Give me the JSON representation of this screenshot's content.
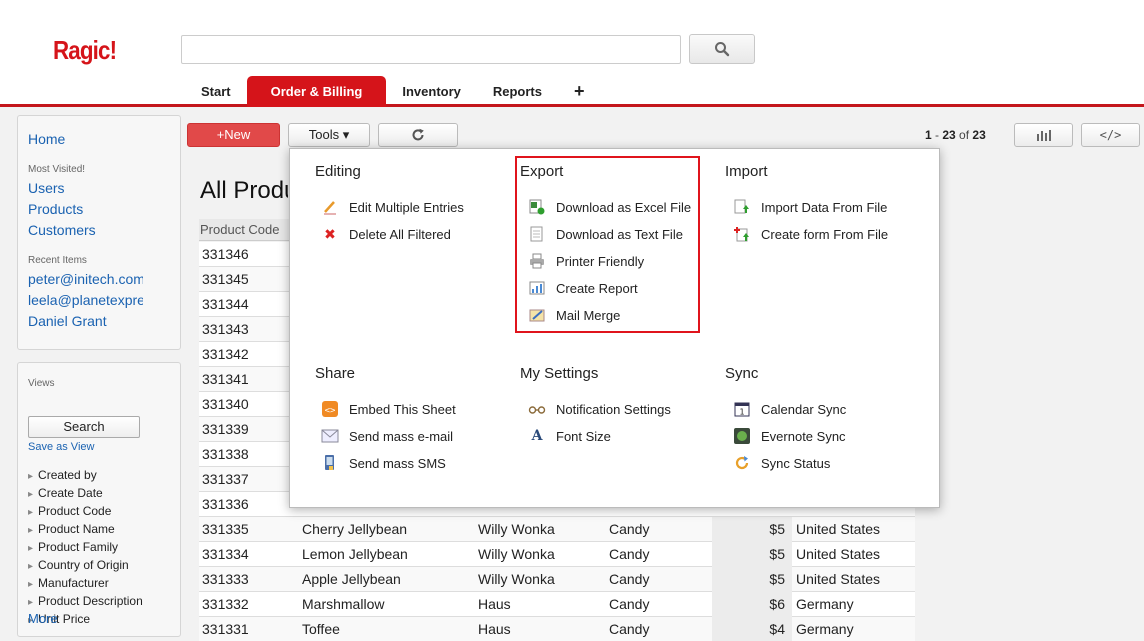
{
  "app": {
    "logo": "Ragic!"
  },
  "search": {
    "placeholder": ""
  },
  "tabs": [
    {
      "label": "Start"
    },
    {
      "label": "Order & Billing"
    },
    {
      "label": "Inventory"
    },
    {
      "label": "Reports"
    },
    {
      "label": "+"
    }
  ],
  "sidebar": {
    "home": "Home",
    "most_visited_label": "Most Visited!",
    "most_visited": [
      "Users",
      "Products",
      "Customers"
    ],
    "recent_label": "Recent Items",
    "recent": [
      "peter@initech.com",
      "leela@planetexpres",
      "Daniel Grant"
    ],
    "views_label": "Views",
    "search_button": "Search",
    "save_as_view": "Save as View",
    "filters": [
      "Created by",
      "Create Date",
      "Product Code",
      "Product Name",
      "Product Family",
      "Country of Origin",
      "Manufacturer",
      "Product Description",
      "Unit Price"
    ],
    "more": "More"
  },
  "toolbar": {
    "new_label": "+New",
    "tools_label": "Tools ▾",
    "pager_start": "1",
    "pager_sep": " - ",
    "pager_end": "23",
    "pager_of": " of ",
    "pager_total": "23",
    "code_label": "</>"
  },
  "main": {
    "title": "All Products",
    "col_product_code": "Product Code",
    "codes": [
      "331346",
      "331345",
      "331344",
      "331343",
      "331342",
      "331341",
      "331340",
      "331339",
      "331338",
      "331337",
      "331336"
    ],
    "rows": [
      {
        "code": "331335",
        "name": "Cherry Jellybean",
        "manufacturer": "Willy Wonka",
        "family": "Candy",
        "price": "$5",
        "country": "United States"
      },
      {
        "code": "331334",
        "name": "Lemon Jellybean",
        "manufacturer": "Willy Wonka",
        "family": "Candy",
        "price": "$5",
        "country": "United States"
      },
      {
        "code": "331333",
        "name": "Apple Jellybean",
        "manufacturer": "Willy Wonka",
        "family": "Candy",
        "price": "$5",
        "country": "United States"
      },
      {
        "code": "331332",
        "name": "Marshmallow",
        "manufacturer": "Haus",
        "family": "Candy",
        "price": "$6",
        "country": "Germany"
      },
      {
        "code": "331331",
        "name": "Toffee",
        "manufacturer": "Haus",
        "family": "Candy",
        "price": "$4",
        "country": "Germany"
      }
    ]
  },
  "tools_menu": {
    "editing": {
      "title": "Editing",
      "items": [
        "Edit Multiple Entries",
        "Delete All Filtered"
      ]
    },
    "export": {
      "title": "Export",
      "items": [
        "Download as Excel File",
        "Download as Text File",
        "Printer Friendly",
        "Create Report",
        "Mail Merge"
      ]
    },
    "import": {
      "title": "Import",
      "items": [
        "Import Data From File",
        "Create form From File"
      ]
    },
    "share": {
      "title": "Share",
      "items": [
        "Embed This Sheet",
        "Send mass e-mail",
        "Send mass SMS"
      ]
    },
    "my_settings": {
      "title": "My Settings",
      "items": [
        "Notification Settings",
        "Font Size"
      ]
    },
    "sync": {
      "title": "Sync",
      "items": [
        "Calendar Sync",
        "Evernote Sync",
        "Sync Status"
      ]
    }
  },
  "colors": {
    "brand": "#d5141a",
    "link": "#1a62b1",
    "highlight": "#e0141c"
  }
}
